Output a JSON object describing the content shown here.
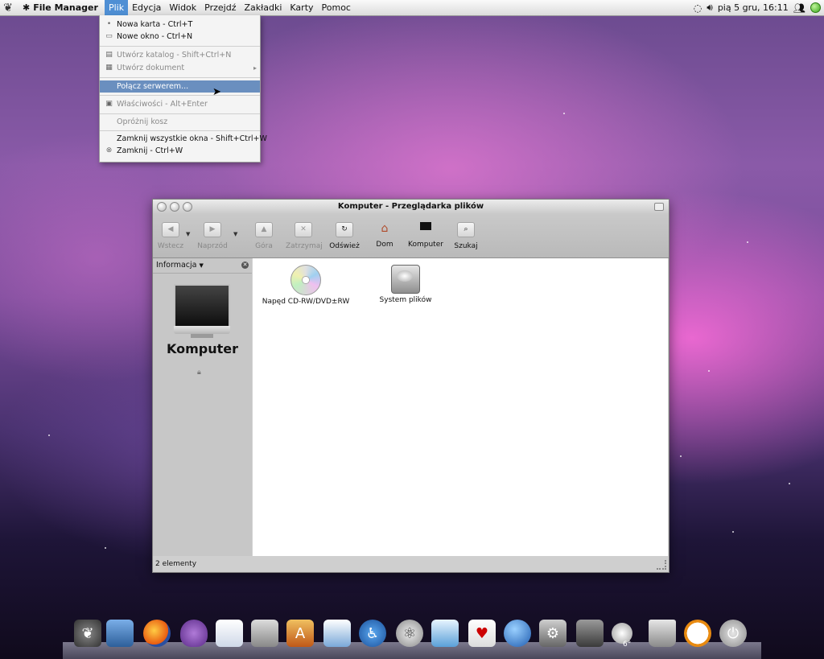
{
  "topbar": {
    "app_name": "File Manager",
    "menus": [
      "Plik",
      "Edycja",
      "Widok",
      "Przejdź",
      "Zakładki",
      "Karty",
      "Pomoc"
    ],
    "clock": "pią  5 gru, 16:11"
  },
  "file_menu": {
    "items": {
      "new_tab": "Nowa karta - Ctrl+T",
      "new_window": "Nowe okno - Ctrl+N",
      "create_folder": "Utwórz katalog - Shift+Ctrl+N",
      "create_document": "Utwórz dokument",
      "connect_server": "Połącz serwerem...",
      "properties": "Właściwości - Alt+Enter",
      "empty_trash": "Opróżnij kosz",
      "close_all": "Zamknij wszystkie okna - Shift+Ctrl+W",
      "close": "Zamknij - Ctrl+W"
    },
    "highlighted": "Połącz serwerem..."
  },
  "window": {
    "title": "Komputer - Przeglądarka plików",
    "toolbar": {
      "back": "Wstecz",
      "forward": "Naprzód",
      "up": "Góra",
      "stop": "Zatrzymaj",
      "reload": "Odśwież",
      "home": "Dom",
      "computer": "Komputer",
      "search": "Szukaj"
    },
    "sidebar": {
      "header": "Informacja",
      "name": "Komputer"
    },
    "items": [
      {
        "label": "Napęd CD-RW/DVD±RW",
        "icon": "cd-icon"
      },
      {
        "label": "System plików",
        "icon": "hard-drive-icon"
      }
    ],
    "status": "2 elementy"
  },
  "dock": {
    "weather_temp": "6°",
    "icons": [
      "gnome-foot-icon",
      "desktop-icon",
      "firefox-icon",
      "pidgin-icon",
      "text-editor-icon",
      "file-cabinet-icon",
      "app-store-icon",
      "mail-calendar-icon",
      "accessibility-icon",
      "atom-icon",
      "quill-icon",
      "cards-icon",
      "network-globe-icon",
      "system-prefs-icon",
      "speaker-icon",
      "weather-icon",
      "trash-icon",
      "clock-icon",
      "power-icon"
    ]
  },
  "colors": {
    "menu_highlight": "#4f8fd4",
    "menu_row_highlight": "#6a8fbf"
  }
}
